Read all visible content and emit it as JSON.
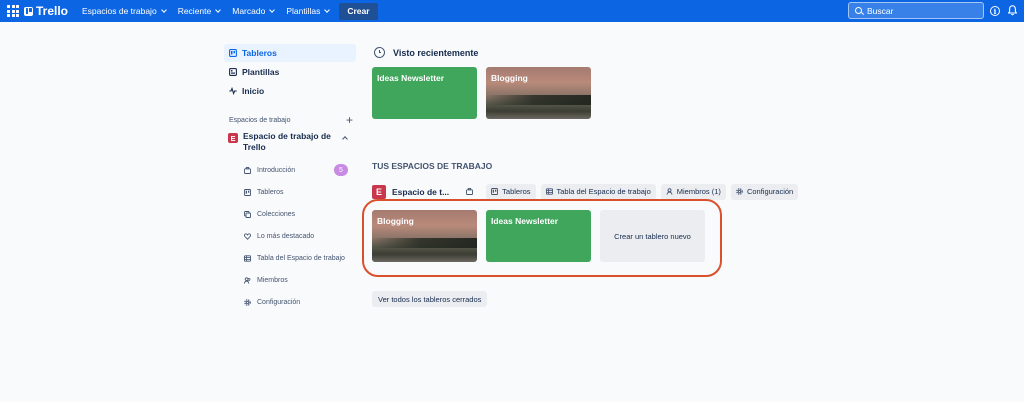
{
  "topbar": {
    "logo": "Trello",
    "nav": [
      {
        "label": "Espacios de trabajo"
      },
      {
        "label": "Reciente"
      },
      {
        "label": "Marcado"
      },
      {
        "label": "Plantillas"
      }
    ],
    "create_label": "Crear",
    "search_placeholder": "Buscar",
    "info_glyph": "i"
  },
  "sidebar": {
    "main_items": [
      {
        "label": "Tableros",
        "icon": "board-icon",
        "active": true
      },
      {
        "label": "Plantillas",
        "icon": "template-icon"
      },
      {
        "label": "Inicio",
        "icon": "pulse-icon"
      }
    ],
    "workspaces_heading": "Espacios de trabajo",
    "add_glyph": "+",
    "workspace": {
      "avatar_letter": "E",
      "name": "Espacio de trabajo de Trello",
      "color": "#c9374d"
    },
    "sub_items": [
      {
        "label": "Introducción",
        "icon": "briefcase-icon",
        "badge": "5"
      },
      {
        "label": "Tableros",
        "icon": "board-icon"
      },
      {
        "label": "Colecciones",
        "icon": "collections-icon"
      },
      {
        "label": "Lo más destacado",
        "icon": "heart-icon"
      },
      {
        "label": "Tabla del Espacio de trabajo",
        "icon": "table-icon"
      },
      {
        "label": "Miembros",
        "icon": "members-icon"
      },
      {
        "label": "Configuración",
        "icon": "gear-icon"
      }
    ]
  },
  "recent": {
    "title": "Visto recientemente",
    "boards": [
      {
        "title": "Ideas Newsletter",
        "style": "green"
      },
      {
        "title": "Blogging",
        "style": "photo"
      }
    ]
  },
  "workspaces": {
    "title": "TUS ESPACIOS DE TRABAJO",
    "avatar_letter": "E",
    "name": "Espacio de t...",
    "chips": [
      {
        "label": "Tableros",
        "icon": "board-icon"
      },
      {
        "label": "Tabla del Espacio de trabajo",
        "icon": "table-icon"
      },
      {
        "label": "Miembros (1)",
        "icon": "member-icon"
      },
      {
        "label": "Configuración",
        "icon": "gear-icon"
      }
    ],
    "boards": [
      {
        "title": "Blogging",
        "style": "photo"
      },
      {
        "title": "Ideas Newsletter",
        "style": "green"
      }
    ],
    "create_board_label": "Crear un tablero nuevo",
    "closed_boards_label": "Ver todos los tableros cerrados"
  },
  "colors": {
    "topbar": "#0c66e4",
    "board_green": "#3fa65c",
    "highlight": "#d9512c",
    "badge": "#c88be4"
  }
}
